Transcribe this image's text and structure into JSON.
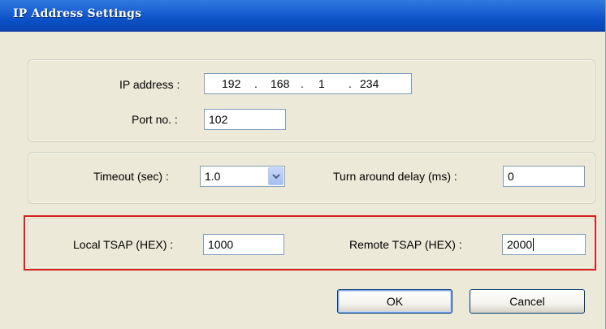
{
  "window": {
    "title": "IP Address Settings"
  },
  "network": {
    "ip_label": "IP address :",
    "ip": [
      "192",
      "168",
      "1",
      "234"
    ],
    "port_label": "Port no. :",
    "port_value": "102"
  },
  "timing": {
    "timeout_label": "Timeout (sec) :",
    "timeout_value": "1.0",
    "turnaround_label": "Turn around delay (ms) :",
    "turnaround_value": "0"
  },
  "tsap": {
    "local_label": "Local TSAP (HEX) :",
    "local_value": "1000",
    "remote_label": "Remote TSAP (HEX) :",
    "remote_value": "2000"
  },
  "buttons": {
    "ok": "OK",
    "cancel": "Cancel"
  },
  "icons": {
    "dropdown": "chevron-down-icon"
  },
  "colors": {
    "titlebar": "#0a4fc4",
    "highlight_border": "#d8201f",
    "dialog_bg": "#ece9d8"
  }
}
